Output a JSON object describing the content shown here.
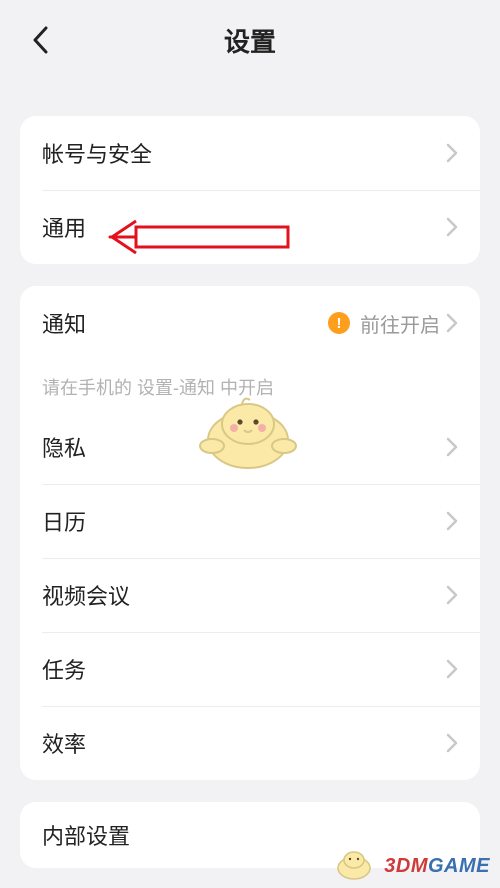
{
  "header": {
    "title": "设置"
  },
  "section1": {
    "items": [
      {
        "label": "帐号与安全"
      },
      {
        "label": "通用"
      }
    ]
  },
  "section2": {
    "items": [
      {
        "label": "通知",
        "value": "前往开启",
        "warn": true
      }
    ],
    "hint": "请在手机的 设置-通知 中开启"
  },
  "section3": {
    "items": [
      {
        "label": "隐私"
      },
      {
        "label": "日历"
      },
      {
        "label": "视频会议"
      },
      {
        "label": "任务"
      },
      {
        "label": "效率"
      }
    ]
  },
  "section4": {
    "items": [
      {
        "label": "内部设置"
      }
    ]
  },
  "watermark": {
    "prefix": "3DM",
    "suffix": "GAME"
  }
}
